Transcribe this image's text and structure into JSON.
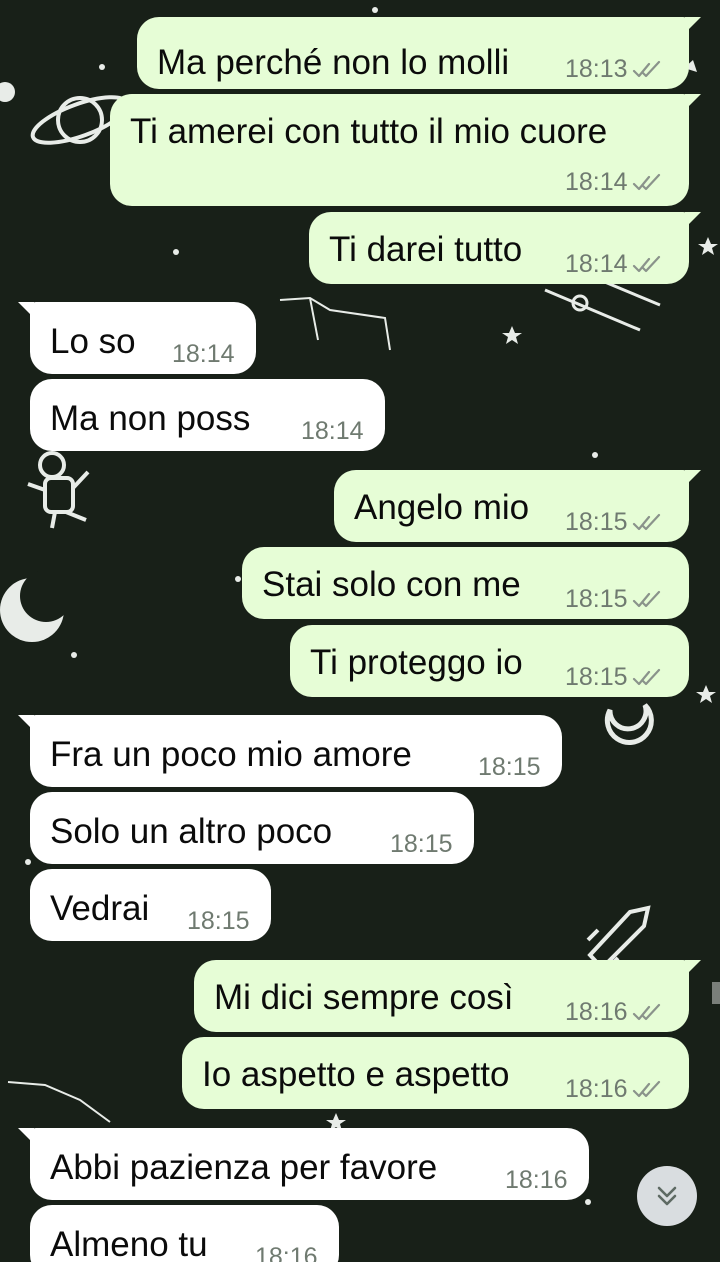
{
  "messages": [
    {
      "dir": "out",
      "text": "Ma perché non lo molli",
      "time": "18:13",
      "read": true
    },
    {
      "dir": "out",
      "text": "Ti amerei con tutto il mio cuore",
      "time": "18:14",
      "read": true
    },
    {
      "dir": "out",
      "text": "Ti darei tutto",
      "time": "18:14",
      "read": true
    },
    {
      "dir": "in",
      "text": "Lo so",
      "time": "18:14"
    },
    {
      "dir": "in",
      "text": "Ma non poss",
      "time": "18:14"
    },
    {
      "dir": "out",
      "text": "Angelo mio",
      "time": "18:15",
      "read": true
    },
    {
      "dir": "out",
      "text": "Stai solo con me",
      "time": "18:15",
      "read": true
    },
    {
      "dir": "out",
      "text": "Ti proteggo io",
      "time": "18:15",
      "read": true
    },
    {
      "dir": "in",
      "text": "Fra un poco mio amore",
      "time": "18:15"
    },
    {
      "dir": "in",
      "text": "Solo un altro poco",
      "time": "18:15"
    },
    {
      "dir": "in",
      "text": "Vedrai",
      "time": "18:15"
    },
    {
      "dir": "out",
      "text": "Mi dici sempre così",
      "time": "18:16",
      "read": true
    },
    {
      "dir": "out",
      "text": "Io aspetto e aspetto",
      "time": "18:16",
      "read": true
    },
    {
      "dir": "in",
      "text": "Abbi pazienza per favore",
      "time": "18:16"
    },
    {
      "dir": "in",
      "text": "Almeno tu",
      "time": "18:16"
    }
  ],
  "colors": {
    "outgoing_bubble": "#e6fdd6",
    "incoming_bubble": "#ffffff",
    "background": "#182018",
    "timestamp": "#6f7a70",
    "read_ticks": "#8a938b"
  },
  "icons": {
    "read_receipt": "double-check-icon",
    "scroll_button": "chevron-double-down-icon"
  }
}
